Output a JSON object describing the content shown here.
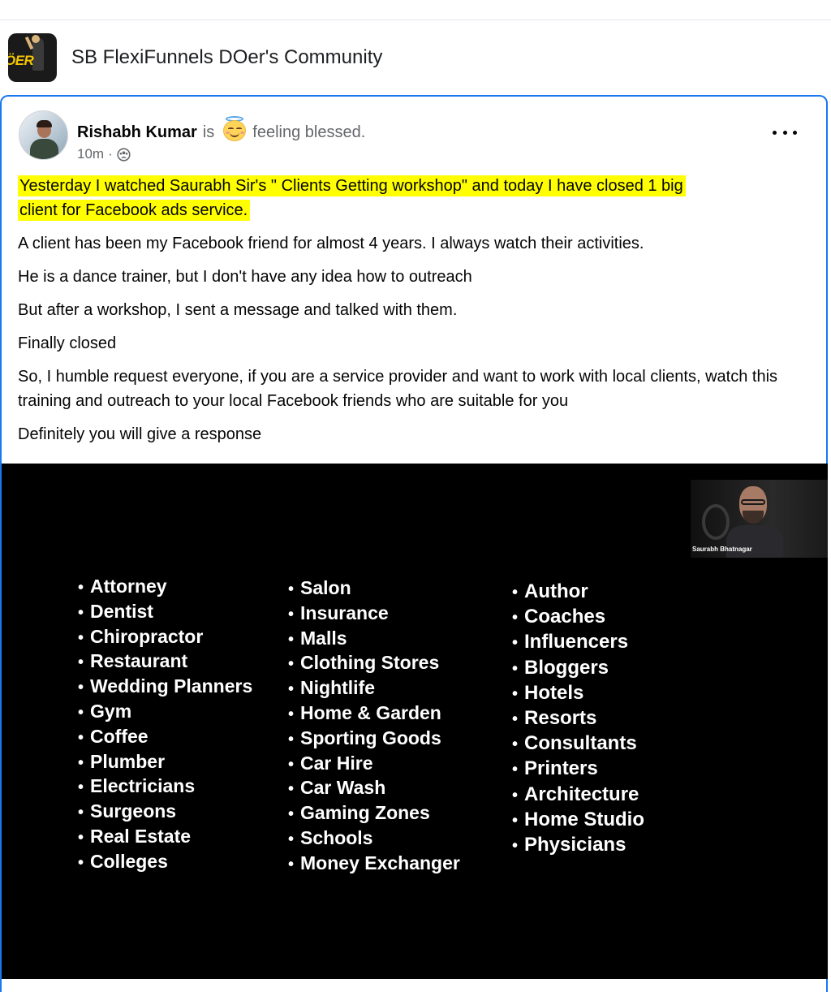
{
  "group": {
    "title": "SB FlexiFunnels DOer's Community",
    "logo_text": "ÖER"
  },
  "post": {
    "author": "Rishabh Kumar",
    "is_word": "is",
    "feeling_emoji": "smiling-face-with-halo",
    "feeling": "feeling blessed.",
    "time": "10m",
    "meta_separator": "·",
    "privacy_icon": "group-members-icon",
    "paragraphs": [
      "A client has been my Facebook friend for almost 4 years. I always watch their activities.",
      "He is a dance trainer, but I don't have any idea how to outreach",
      "But after a workshop, I sent a message and talked with them.",
      "Finally closed",
      "So, I humble request everyone, if you are a service provider and want to work with local clients, watch this training and outreach to your local Facebook friends who are suitable for you",
      "Definitely you will give a response"
    ],
    "highlight_line1": "Yesterday I watched Saurabh Sir's  \" Clients Getting workshop\" and today I have closed 1 big",
    "highlight_line2": "client for Facebook ads service.",
    "highlight_color": "#ffff00"
  },
  "media": {
    "presenter_name": "Saurabh Bhatnagar",
    "column1": [
      "Attorney",
      "Dentist",
      "Chiropractor",
      "Restaurant",
      "Wedding Planners",
      "Gym",
      "Coffee",
      "Plumber",
      "Electricians",
      "Surgeons",
      "Real Estate",
      "Colleges"
    ],
    "column2": [
      "Salon",
      "Insurance",
      "Malls",
      "Clothing Stores",
      "Nightlife",
      "Home & Garden",
      "Sporting Goods",
      "Car Hire",
      "Car Wash",
      "Gaming Zones",
      "Schools",
      "Money Exchanger"
    ],
    "column3": [
      "Author",
      "Coaches",
      "Influencers",
      "Bloggers",
      "Hotels",
      "Resorts",
      "Consultants",
      "Printers",
      "Architecture",
      "Home Studio",
      "Physicians"
    ]
  },
  "colors": {
    "focus_border": "#1877f2",
    "secondary_text": "#65676b"
  }
}
